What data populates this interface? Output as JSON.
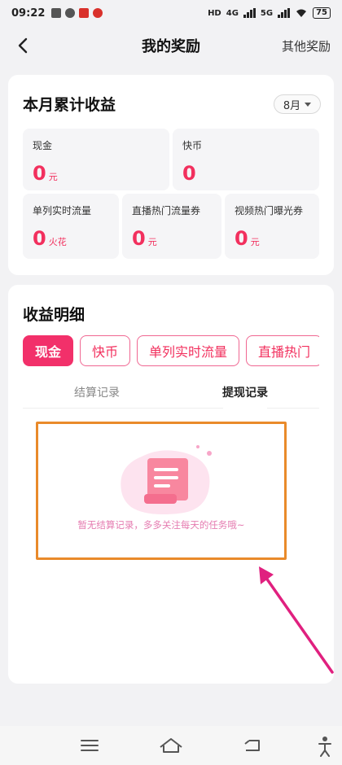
{
  "status_bar": {
    "time": "09:22",
    "network_hd": "HD",
    "network_4g": "4G",
    "network_5g": "5G",
    "battery": "75"
  },
  "nav": {
    "title": "我的奖励",
    "right_link": "其他奖励"
  },
  "earnings": {
    "title": "本月累计收益",
    "month": "8月",
    "tiles": [
      {
        "label": "现金",
        "value": "0",
        "unit": "元"
      },
      {
        "label": "快币",
        "value": "0",
        "unit": ""
      },
      {
        "label": "单列实时流量",
        "value": "0",
        "unit": "火花"
      },
      {
        "label": "直播热门流量券",
        "value": "0",
        "unit": "元"
      },
      {
        "label": "视频热门曝光券",
        "value": "0",
        "unit": "元"
      }
    ]
  },
  "details": {
    "title": "收益明细",
    "filters": [
      "现金",
      "快币",
      "单列实时流量",
      "直播热门"
    ],
    "sub_tabs": [
      "结算记录",
      "提现记录"
    ],
    "empty_text": "暂无结算记录，多多关注每天的任务哦~"
  },
  "colors": {
    "accent": "#f2305e",
    "annotation_box": "#e98a2a",
    "annotation_arrow": "#e0207f"
  },
  "system_nav": {
    "icons": [
      "menu-icon",
      "home-icon",
      "back-icon",
      "accessibility-icon"
    ]
  }
}
